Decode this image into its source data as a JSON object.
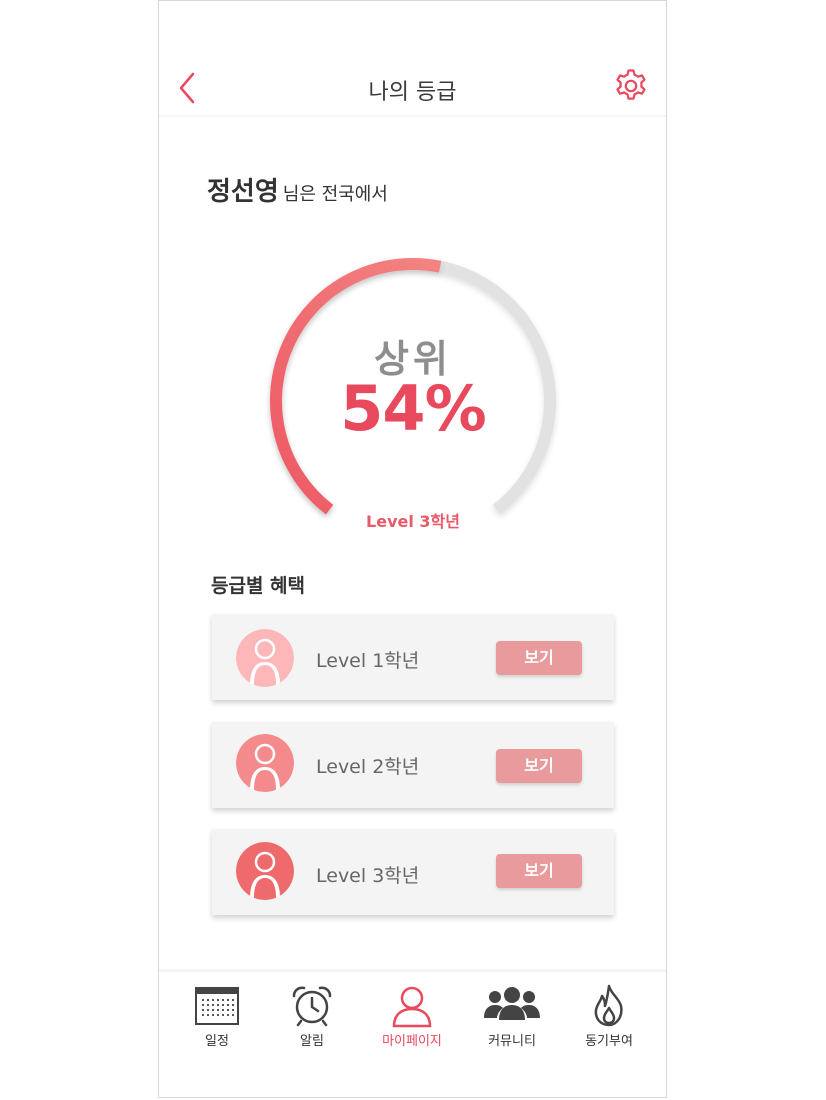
{
  "header": {
    "title": "나의 등급"
  },
  "greeting": {
    "name": "정선영",
    "suffix": "님은 전국에서"
  },
  "rank": {
    "label": "상위",
    "value": "54%",
    "current_level": "Level 3학년",
    "gauge_fraction": 0.54
  },
  "benefits": {
    "title": "등급별 혜택",
    "items": [
      {
        "level": "Level 1학년",
        "button": "보기",
        "color": "#fdb7b9"
      },
      {
        "level": "Level 2학년",
        "button": "보기",
        "color": "#f48a8c"
      },
      {
        "level": "Level 3학년",
        "button": "보기",
        "color": "#ee6a6d"
      }
    ]
  },
  "tabbar": {
    "items": [
      {
        "label": "일정",
        "icon": "calendar-icon"
      },
      {
        "label": "알림",
        "icon": "alarm-clock-icon"
      },
      {
        "label": "마이페이지",
        "icon": "person-icon",
        "active": true
      },
      {
        "label": "커뮤니티",
        "icon": "group-icon"
      },
      {
        "label": "동기부여",
        "icon": "flame-icon"
      }
    ]
  },
  "colors": {
    "accent": "#e8495d",
    "gauge_track": "#e2e2e2",
    "button": "#e89a9c"
  }
}
